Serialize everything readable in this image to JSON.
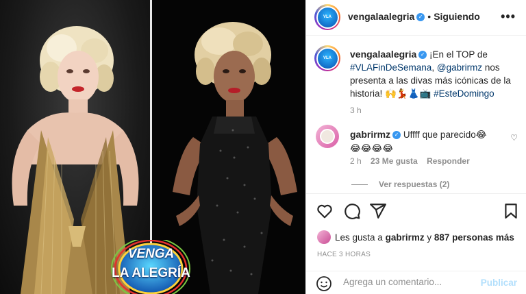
{
  "post": {
    "username": "vengalaalegria",
    "follow_status": "Siguiendo",
    "separator": "•",
    "more_icon": "more-horizontal-icon",
    "logo_text": "VENGA LA ALEGRÍA",
    "logo_line1": "VENGA",
    "logo_line2": "LA ALEGRÍA"
  },
  "caption": {
    "username": "vengalaalegria",
    "text1": "¡En el TOP de",
    "hashtag1": "#VLAFinDeSemana",
    "text2": ",",
    "mention": "@gabrirmz",
    "text3": "nos presenta a las divas más icónicas de la historia!",
    "emoji": "🙌💃👗📺",
    "hashtag2": "#EsteDomingo",
    "time": "3 h"
  },
  "comment": {
    "username": "gabrirmz",
    "text": "Uffff que parecido😂",
    "emoji_line": "😂😂😂😂",
    "time": "2 h",
    "likes": "23 Me gusta",
    "reply": "Responder",
    "view_replies": "Ver respuestas (2)"
  },
  "likes": {
    "prefix": "Les gusta a",
    "user": "gabrirmz",
    "middle": "y",
    "count": "887 personas más"
  },
  "posted_ago": "HACE 3 HORAS",
  "add_comment": {
    "placeholder": "Agrega un comentario...",
    "publish": "Publicar"
  },
  "colors": {
    "link": "#00376b",
    "verified": "#3897f0",
    "publish_disabled": "#b2dffc"
  }
}
